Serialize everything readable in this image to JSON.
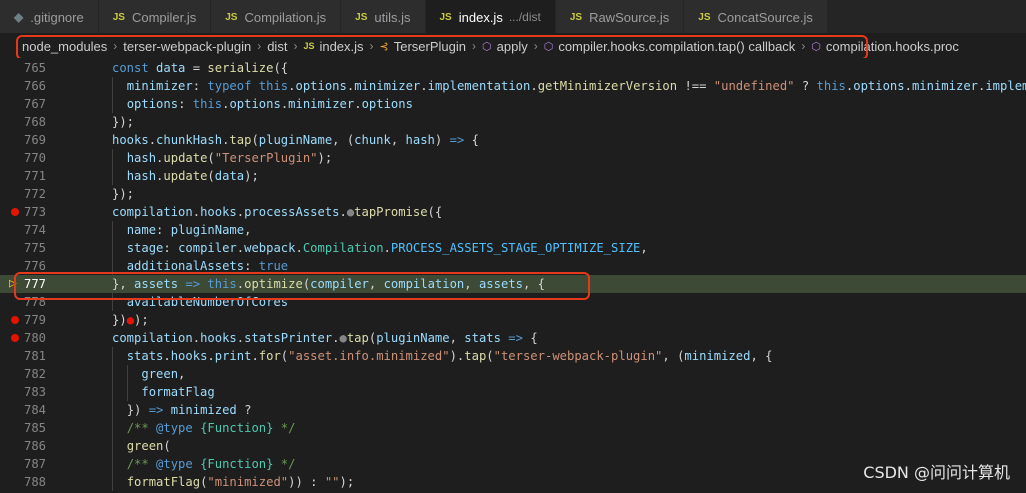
{
  "tabs": [
    {
      "label": ".gitignore",
      "icon": "git-icon",
      "description": ""
    },
    {
      "label": "Compiler.js",
      "icon": "js-icon",
      "description": ""
    },
    {
      "label": "Compilation.js",
      "icon": "js-icon",
      "description": ""
    },
    {
      "label": "utils.js",
      "icon": "js-icon",
      "description": ""
    },
    {
      "label": "index.js",
      "icon": "js-icon",
      "description": ".../dist",
      "active": true
    },
    {
      "label": "RawSource.js",
      "icon": "js-icon",
      "description": ""
    },
    {
      "label": "ConcatSource.js",
      "icon": "js-icon",
      "description": ""
    }
  ],
  "breadcrumb": {
    "items": [
      {
        "label": "node_modules",
        "icon": ""
      },
      {
        "label": "terser-webpack-plugin",
        "icon": ""
      },
      {
        "label": "dist",
        "icon": ""
      },
      {
        "label": "index.js",
        "icon": "JS"
      },
      {
        "label": "TerserPlugin",
        "icon": "class-icon"
      },
      {
        "label": "apply",
        "icon": "method-icon"
      },
      {
        "label": "compiler.hooks.compilation.tap() callback",
        "icon": "method-icon"
      },
      {
        "label": "compilation.hooks.proc",
        "icon": "method-icon"
      }
    ]
  },
  "editor": {
    "current_line": 777,
    "lines": [
      {
        "n": 765,
        "indent": 1,
        "tokens": [
          [
            "kw",
            "const "
          ],
          [
            "var",
            "data"
          ],
          [
            "plain",
            " = "
          ],
          [
            "fn",
            "serialize"
          ],
          [
            "plain",
            "({"
          ]
        ]
      },
      {
        "n": 766,
        "indent": 2,
        "tokens": [
          [
            "var",
            "minimizer"
          ],
          [
            "plain",
            ": "
          ],
          [
            "kw",
            "typeof "
          ],
          [
            "kw",
            "this"
          ],
          [
            "plain",
            "."
          ],
          [
            "var",
            "options"
          ],
          [
            "plain",
            "."
          ],
          [
            "var",
            "minimizer"
          ],
          [
            "plain",
            "."
          ],
          [
            "var",
            "implementation"
          ],
          [
            "plain",
            "."
          ],
          [
            "fn",
            "getMinimizerVersion"
          ],
          [
            "plain",
            " !== "
          ],
          [
            "str",
            "\"undefined\""
          ],
          [
            "plain",
            " ? "
          ],
          [
            "kw",
            "this"
          ],
          [
            "plain",
            "."
          ],
          [
            "var",
            "options"
          ],
          [
            "plain",
            "."
          ],
          [
            "var",
            "minimizer"
          ],
          [
            "plain",
            "."
          ],
          [
            "var",
            "impleme"
          ]
        ]
      },
      {
        "n": 767,
        "indent": 2,
        "tokens": [
          [
            "var",
            "options"
          ],
          [
            "plain",
            ": "
          ],
          [
            "kw",
            "this"
          ],
          [
            "plain",
            "."
          ],
          [
            "var",
            "options"
          ],
          [
            "plain",
            "."
          ],
          [
            "var",
            "minimizer"
          ],
          [
            "plain",
            "."
          ],
          [
            "var",
            "options"
          ]
        ]
      },
      {
        "n": 768,
        "indent": 1,
        "tokens": [
          [
            "plain",
            "});"
          ]
        ]
      },
      {
        "n": 769,
        "indent": 1,
        "tokens": [
          [
            "var",
            "hooks"
          ],
          [
            "plain",
            "."
          ],
          [
            "var",
            "chunkHash"
          ],
          [
            "plain",
            "."
          ],
          [
            "fn",
            "tap"
          ],
          [
            "plain",
            "("
          ],
          [
            "var",
            "pluginName"
          ],
          [
            "plain",
            ", ("
          ],
          [
            "var",
            "chunk"
          ],
          [
            "plain",
            ", "
          ],
          [
            "var",
            "hash"
          ],
          [
            "plain",
            ") "
          ],
          [
            "kw",
            "=>"
          ],
          [
            "plain",
            " {"
          ]
        ]
      },
      {
        "n": 770,
        "indent": 2,
        "tokens": [
          [
            "var",
            "hash"
          ],
          [
            "plain",
            "."
          ],
          [
            "fn",
            "update"
          ],
          [
            "plain",
            "("
          ],
          [
            "str",
            "\"TerserPlugin\""
          ],
          [
            "plain",
            ");"
          ]
        ]
      },
      {
        "n": 771,
        "indent": 2,
        "tokens": [
          [
            "var",
            "hash"
          ],
          [
            "plain",
            "."
          ],
          [
            "fn",
            "update"
          ],
          [
            "plain",
            "("
          ],
          [
            "var",
            "data"
          ],
          [
            "plain",
            ");"
          ]
        ]
      },
      {
        "n": 772,
        "indent": 1,
        "tokens": [
          [
            "plain",
            "});"
          ]
        ]
      },
      {
        "n": 773,
        "indent": 1,
        "breakpoint": true,
        "tokens": [
          [
            "var",
            "compilation"
          ],
          [
            "plain",
            "."
          ],
          [
            "var",
            "hooks"
          ],
          [
            "plain",
            "."
          ],
          [
            "var",
            "processAssets"
          ],
          [
            "plain",
            "."
          ],
          [
            "inl",
            "●"
          ],
          [
            "fn",
            "tapPromise"
          ],
          [
            "plain",
            "({"
          ]
        ]
      },
      {
        "n": 774,
        "indent": 2,
        "tokens": [
          [
            "var",
            "name"
          ],
          [
            "plain",
            ": "
          ],
          [
            "var",
            "pluginName"
          ],
          [
            "plain",
            ","
          ]
        ]
      },
      {
        "n": 775,
        "indent": 2,
        "tokens": [
          [
            "var",
            "stage"
          ],
          [
            "plain",
            ": "
          ],
          [
            "var",
            "compiler"
          ],
          [
            "plain",
            "."
          ],
          [
            "var",
            "webpack"
          ],
          [
            "plain",
            "."
          ],
          [
            "cls",
            "Compilation"
          ],
          [
            "plain",
            "."
          ],
          [
            "const",
            "PROCESS_ASSETS_STAGE_OPTIMIZE_SIZE"
          ],
          [
            "plain",
            ","
          ]
        ]
      },
      {
        "n": 776,
        "indent": 2,
        "tokens": [
          [
            "var",
            "additionalAssets"
          ],
          [
            "plain",
            ": "
          ],
          [
            "kw",
            "true"
          ]
        ]
      },
      {
        "n": 777,
        "indent": 1,
        "current": true,
        "tokens": [
          [
            "plain",
            "}, "
          ],
          [
            "var",
            "assets"
          ],
          [
            "plain",
            " "
          ],
          [
            "kw",
            "=>"
          ],
          [
            "plain",
            " "
          ],
          [
            "kw",
            "this"
          ],
          [
            "plain",
            "."
          ],
          [
            "fn",
            "optimize"
          ],
          [
            "plain",
            "("
          ],
          [
            "var",
            "compiler"
          ],
          [
            "plain",
            ", "
          ],
          [
            "var",
            "compilation"
          ],
          [
            "plain",
            ", "
          ],
          [
            "var",
            "assets"
          ],
          [
            "plain",
            ", {"
          ]
        ]
      },
      {
        "n": 778,
        "indent": 2,
        "tokens": [
          [
            "var",
            "availableNumberOfCores"
          ]
        ]
      },
      {
        "n": 779,
        "indent": 1,
        "breakpoint": true,
        "tokens": [
          [
            "plain",
            "})"
          ],
          [
            "inlbp",
            "●"
          ],
          [
            "plain",
            ");"
          ]
        ]
      },
      {
        "n": 780,
        "indent": 1,
        "breakpoint": true,
        "tokens": [
          [
            "var",
            "compilation"
          ],
          [
            "plain",
            "."
          ],
          [
            "var",
            "hooks"
          ],
          [
            "plain",
            "."
          ],
          [
            "var",
            "statsPrinter"
          ],
          [
            "plain",
            "."
          ],
          [
            "inl",
            "●"
          ],
          [
            "fn",
            "tap"
          ],
          [
            "plain",
            "("
          ],
          [
            "var",
            "pluginName"
          ],
          [
            "plain",
            ", "
          ],
          [
            "var",
            "stats"
          ],
          [
            "plain",
            " "
          ],
          [
            "kw",
            "=>"
          ],
          [
            "plain",
            " {"
          ]
        ]
      },
      {
        "n": 781,
        "indent": 2,
        "tokens": [
          [
            "var",
            "stats"
          ],
          [
            "plain",
            "."
          ],
          [
            "var",
            "hooks"
          ],
          [
            "plain",
            "."
          ],
          [
            "var",
            "print"
          ],
          [
            "plain",
            "."
          ],
          [
            "fn",
            "for"
          ],
          [
            "plain",
            "("
          ],
          [
            "str",
            "\"asset.info.minimized\""
          ],
          [
            "plain",
            ")."
          ],
          [
            "fn",
            "tap"
          ],
          [
            "plain",
            "("
          ],
          [
            "str",
            "\"terser-webpack-plugin\""
          ],
          [
            "plain",
            ", ("
          ],
          [
            "var",
            "minimized"
          ],
          [
            "plain",
            ", {"
          ]
        ]
      },
      {
        "n": 782,
        "indent": 3,
        "tokens": [
          [
            "var",
            "green"
          ],
          [
            "plain",
            ","
          ]
        ]
      },
      {
        "n": 783,
        "indent": 3,
        "tokens": [
          [
            "var",
            "formatFlag"
          ]
        ]
      },
      {
        "n": 784,
        "indent": 2,
        "tokens": [
          [
            "plain",
            "}) "
          ],
          [
            "kw",
            "=>"
          ],
          [
            "plain",
            " "
          ],
          [
            "var",
            "minimized"
          ],
          [
            "plain",
            " ?"
          ]
        ]
      },
      {
        "n": 785,
        "indent": 2,
        "tokens": [
          [
            "cmt",
            "/** "
          ],
          [
            "kw",
            "@type"
          ],
          [
            "cmt",
            " "
          ],
          [
            "cls",
            "{Function}"
          ],
          [
            "cmt",
            " */"
          ]
        ]
      },
      {
        "n": 786,
        "indent": 2,
        "tokens": [
          [
            "fn",
            "green"
          ],
          [
            "plain",
            "("
          ]
        ]
      },
      {
        "n": 787,
        "indent": 2,
        "tokens": [
          [
            "cmt",
            "/** "
          ],
          [
            "kw",
            "@type"
          ],
          [
            "cmt",
            " "
          ],
          [
            "cls",
            "{Function}"
          ],
          [
            "cmt",
            " */"
          ]
        ]
      },
      {
        "n": 788,
        "indent": 2,
        "tokens": [
          [
            "fn",
            "formatFlag"
          ],
          [
            "plain",
            "("
          ],
          [
            "str",
            "\"minimized\""
          ],
          [
            "plain",
            ")) : "
          ],
          [
            "str",
            "\"\""
          ],
          [
            "plain",
            ");"
          ]
        ]
      }
    ]
  },
  "watermark": "CSDN @问问计算机"
}
